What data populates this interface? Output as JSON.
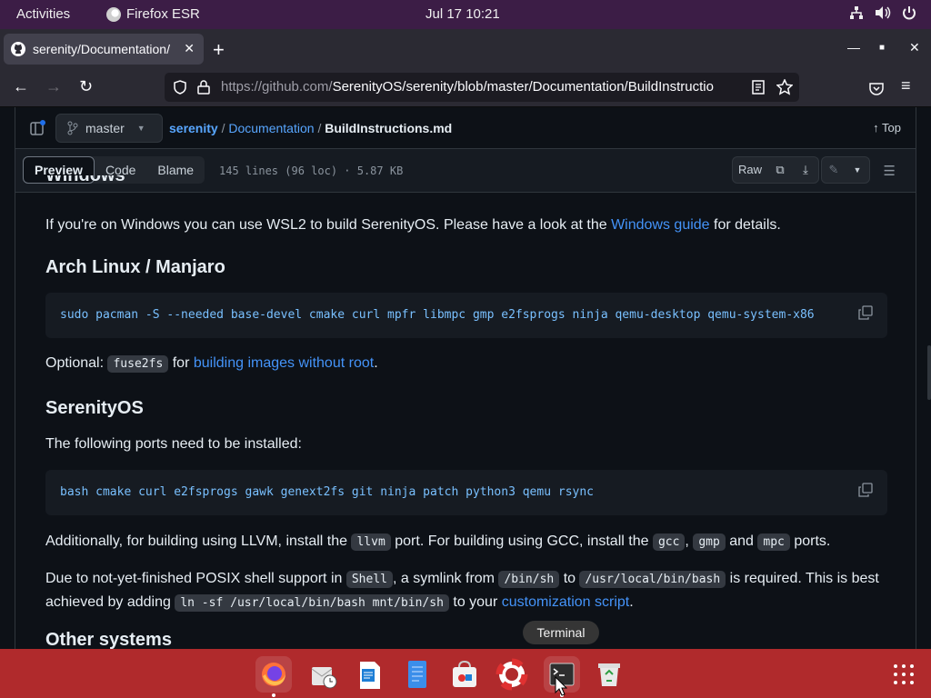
{
  "topbar": {
    "activities": "Activities",
    "app_name": "Firefox ESR",
    "clock": "Jul 17  10:21"
  },
  "browser": {
    "tab_title": "serenity/Documentation/",
    "url_host": "https://github.com/",
    "url_path": "SerenityOS/serenity/blob/master/Documentation/BuildInstructio"
  },
  "github": {
    "branch": "master",
    "crumb_repo": "serenity",
    "crumb_sep": "/",
    "crumb_dir": "Documentation",
    "crumb_file": "BuildInstructions.md",
    "top_label": "Top",
    "tabs": [
      "Preview",
      "Code",
      "Blame"
    ],
    "meta": "145 lines (96 loc) · 5.87 KB",
    "raw_label": "Raw"
  },
  "markdown": {
    "partial_heading": "Windows",
    "windows_text_pre": "If you're on Windows you can use WSL2 to build SerenityOS. Please have a look at the ",
    "windows_link": "Windows guide",
    "windows_text_post": " for details.",
    "arch_heading": "Arch Linux / Manjaro",
    "arch_code": "sudo pacman -S --needed base-devel cmake curl mpfr libmpc gmp e2fsprogs ninja qemu-desktop qemu-system-x86",
    "optional_pre": "Optional: ",
    "optional_code": "fuse2fs",
    "optional_mid": " for ",
    "optional_link": "building images without root",
    "optional_post": ".",
    "serenity_heading": "SerenityOS",
    "ports_text": "The following ports need to be installed:",
    "ports_code": "bash cmake curl e2fsprogs gawk genext2fs git ninja patch python3 qemu rsync",
    "llvm_pre": "Additionally, for building using LLVM, install the ",
    "llvm_code": "llvm",
    "llvm_mid": " port. For building using GCC, install the ",
    "gcc_code": "gcc",
    "comma": ", ",
    "gmp_code": "gmp",
    "and": " and ",
    "mpc_code": "mpc",
    "ports_end": " ports.",
    "posix_pre": "Due to not-yet-finished POSIX shell support in ",
    "shell_code": "Shell",
    "posix_mid": ", a symlink from ",
    "binsh_code": "/bin/sh",
    "to": " to ",
    "bash_code": "/usr/local/bin/bash",
    "posix_mid2": " is required. This is best achieved by adding ",
    "ln_code": "ln -sf /usr/local/bin/bash mnt/bin/sh",
    "posix_mid3": " to your ",
    "custom_link": "customization script",
    "posix_end": ".",
    "partial_bottom_heading": "Other systems"
  },
  "dock": {
    "tooltip": "Terminal"
  }
}
